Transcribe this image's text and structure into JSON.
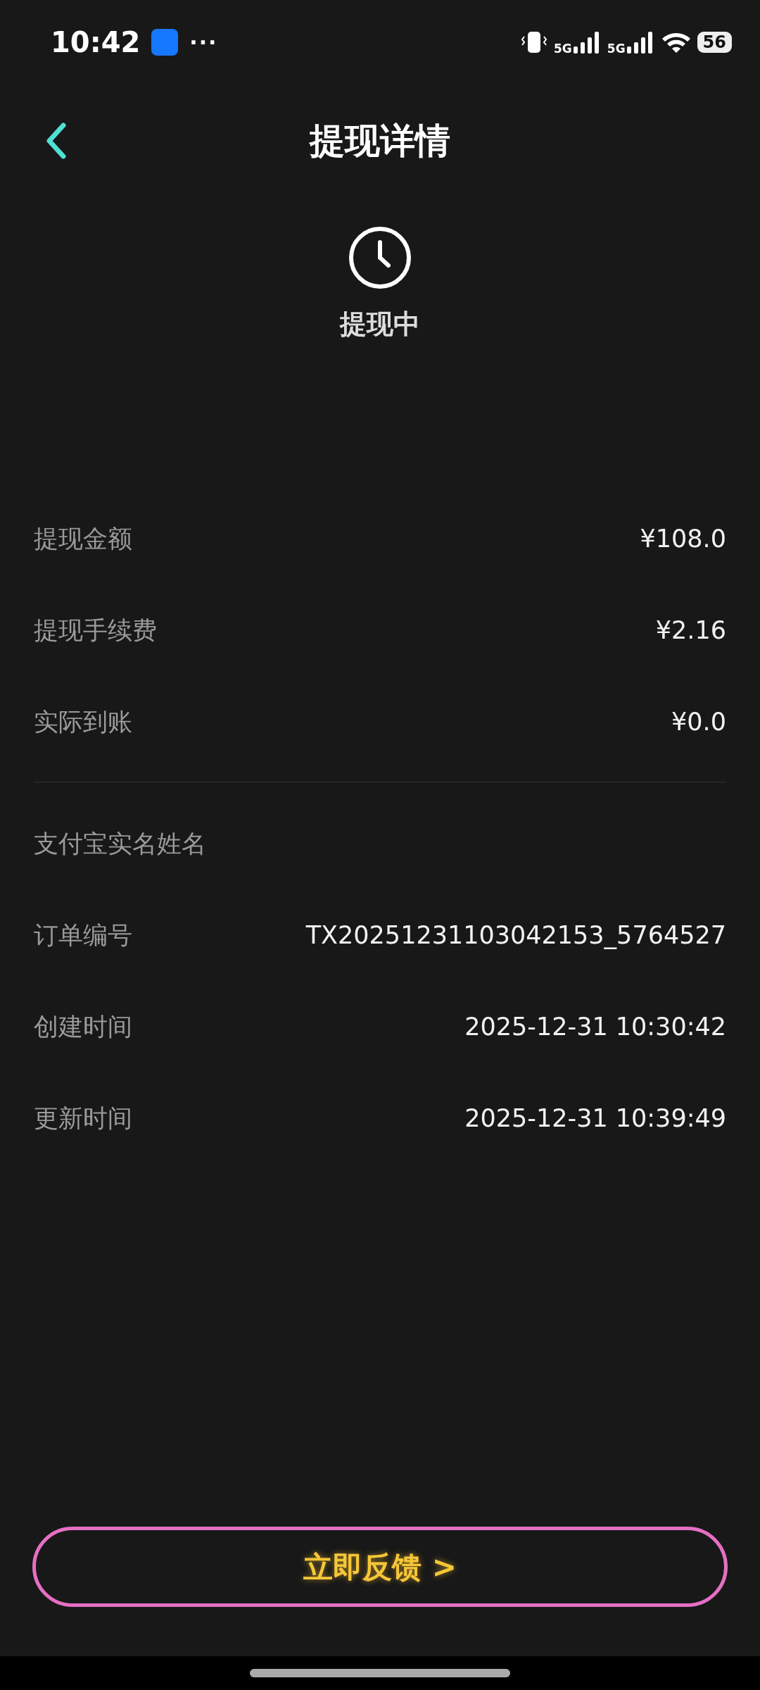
{
  "status_bar": {
    "time": "10:42",
    "more": "···",
    "network_1": "5G",
    "network_2": "5G",
    "battery": "56"
  },
  "header": {
    "title": "提现详情"
  },
  "status": {
    "label": "提现中"
  },
  "sections": [
    {
      "rows": [
        {
          "label": "提现金额",
          "value": "¥108.0"
        },
        {
          "label": "提现手续费",
          "value": "¥2.16"
        },
        {
          "label": "实际到账",
          "value": "¥0.0"
        }
      ]
    },
    {
      "rows": [
        {
          "label": "支付宝实名姓名"
        },
        {
          "label": "订单编号",
          "value": "TX20251231103042153_5764527"
        },
        {
          "label": "创建时间",
          "value": "2025-12-31 10:30:42"
        },
        {
          "label": "更新时间",
          "value": "2025-12-31 10:39:49"
        }
      ]
    }
  ],
  "feedback_button": {
    "label": "立即反馈 >"
  }
}
